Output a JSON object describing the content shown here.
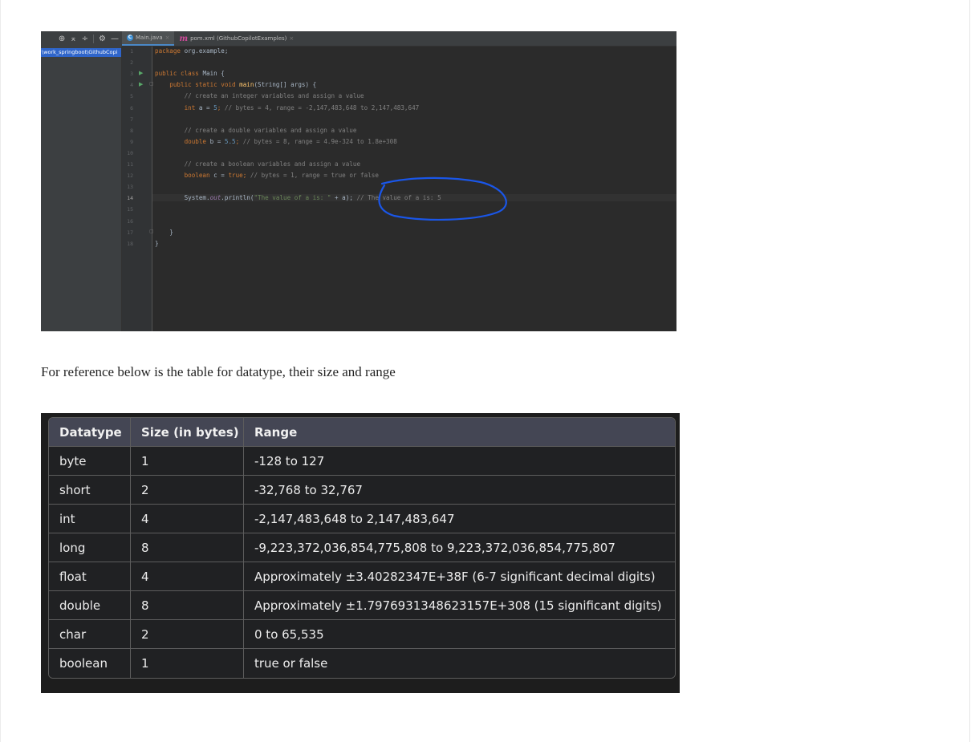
{
  "ide": {
    "toolbar_icons": [
      "globe-icon",
      "collapse-icon",
      "expand-icon",
      "gear-icon",
      "minus-icon"
    ],
    "tabs": [
      {
        "label": "Main.java",
        "active": true,
        "icon": "java-class-icon"
      },
      {
        "label": "pom.xml (GithubCopilotExamples)",
        "active": false,
        "icon": "maven-icon"
      }
    ],
    "tab_close_glyph": "×",
    "project_path": "\\work_springboot\\GithubCopi",
    "annotation": {
      "shape": "hand-drawn ellipse",
      "color": "#1a56e8"
    },
    "lines": [
      {
        "n": "1",
        "tokens": [
          [
            "kw",
            "package "
          ],
          [
            "",
            "org.example;"
          ]
        ]
      },
      {
        "n": "2",
        "tokens": []
      },
      {
        "n": "3",
        "run": true,
        "tokens": [
          [
            "kw",
            "public class "
          ],
          [
            "",
            "Main {"
          ]
        ]
      },
      {
        "n": "4",
        "run": true,
        "fold": true,
        "tokens": [
          [
            "kw",
            "    public static void "
          ],
          [
            "fn",
            "main"
          ],
          [
            "",
            "(String[] args) {"
          ]
        ]
      },
      {
        "n": "5",
        "tokens": [
          [
            "cmt",
            "        // create an integer variables and assign a value"
          ]
        ]
      },
      {
        "n": "6",
        "tokens": [
          [
            "kw",
            "        int "
          ],
          [
            "",
            "a = "
          ],
          [
            "num",
            "5"
          ],
          [
            "kw",
            "; "
          ],
          [
            "cmt",
            "// bytes = 4, range = -2,147,483,648 to 2,147,483,647"
          ]
        ]
      },
      {
        "n": "7",
        "tokens": []
      },
      {
        "n": "8",
        "tokens": [
          [
            "cmt",
            "        // create a double variables and assign a value"
          ]
        ]
      },
      {
        "n": "9",
        "tokens": [
          [
            "kw",
            "        double "
          ],
          [
            "",
            "b = "
          ],
          [
            "num",
            "5.5"
          ],
          [
            "kw",
            "; "
          ],
          [
            "cmt",
            "// bytes = 8, range = 4.9e-324 to 1.8e+308"
          ]
        ]
      },
      {
        "n": "10",
        "tokens": []
      },
      {
        "n": "11",
        "tokens": [
          [
            "cmt",
            "        // create a boolean variables and assign a value"
          ]
        ]
      },
      {
        "n": "12",
        "tokens": [
          [
            "kw",
            "        boolean "
          ],
          [
            "",
            "c = "
          ],
          [
            "kw",
            "true; "
          ],
          [
            "cmt",
            "// bytes = 1, range = true or false"
          ]
        ]
      },
      {
        "n": "13",
        "tokens": []
      },
      {
        "n": "14",
        "current": true,
        "bulb": true,
        "tokens": [
          [
            "",
            "        System."
          ],
          [
            "sys-out",
            "out"
          ],
          [
            "",
            ".println("
          ],
          [
            "str",
            "\"The value of a is: \""
          ],
          [
            "",
            " + a); "
          ],
          [
            "cmt",
            "// The value of a is: 5"
          ]
        ]
      },
      {
        "n": "15",
        "tokens": []
      },
      {
        "n": "16",
        "tokens": []
      },
      {
        "n": "17",
        "fold": true,
        "tokens": [
          [
            "",
            "    }"
          ]
        ]
      },
      {
        "n": "18",
        "tokens": [
          [
            "",
            "}"
          ]
        ]
      }
    ]
  },
  "reference_text": "For reference below is the table for datatype, their size and range",
  "table": {
    "headers": [
      "Datatype",
      "Size (in bytes)",
      "Range"
    ],
    "rows": [
      [
        "byte",
        "1",
        "-128 to 127"
      ],
      [
        "short",
        "2",
        "-32,768 to 32,767"
      ],
      [
        "int",
        "4",
        "-2,147,483,648 to 2,147,483,647"
      ],
      [
        "long",
        "8",
        "-9,223,372,036,854,775,808 to 9,223,372,036,854,775,807"
      ],
      [
        "float",
        "4",
        "Approximately ±3.40282347E+38F (6-7 significant decimal digits)"
      ],
      [
        "double",
        "8",
        "Approximately ±1.7976931348623157E+308 (15 significant digits)"
      ],
      [
        "char",
        "2",
        "0 to 65,535"
      ],
      [
        "boolean",
        "1",
        "true or false"
      ]
    ]
  }
}
